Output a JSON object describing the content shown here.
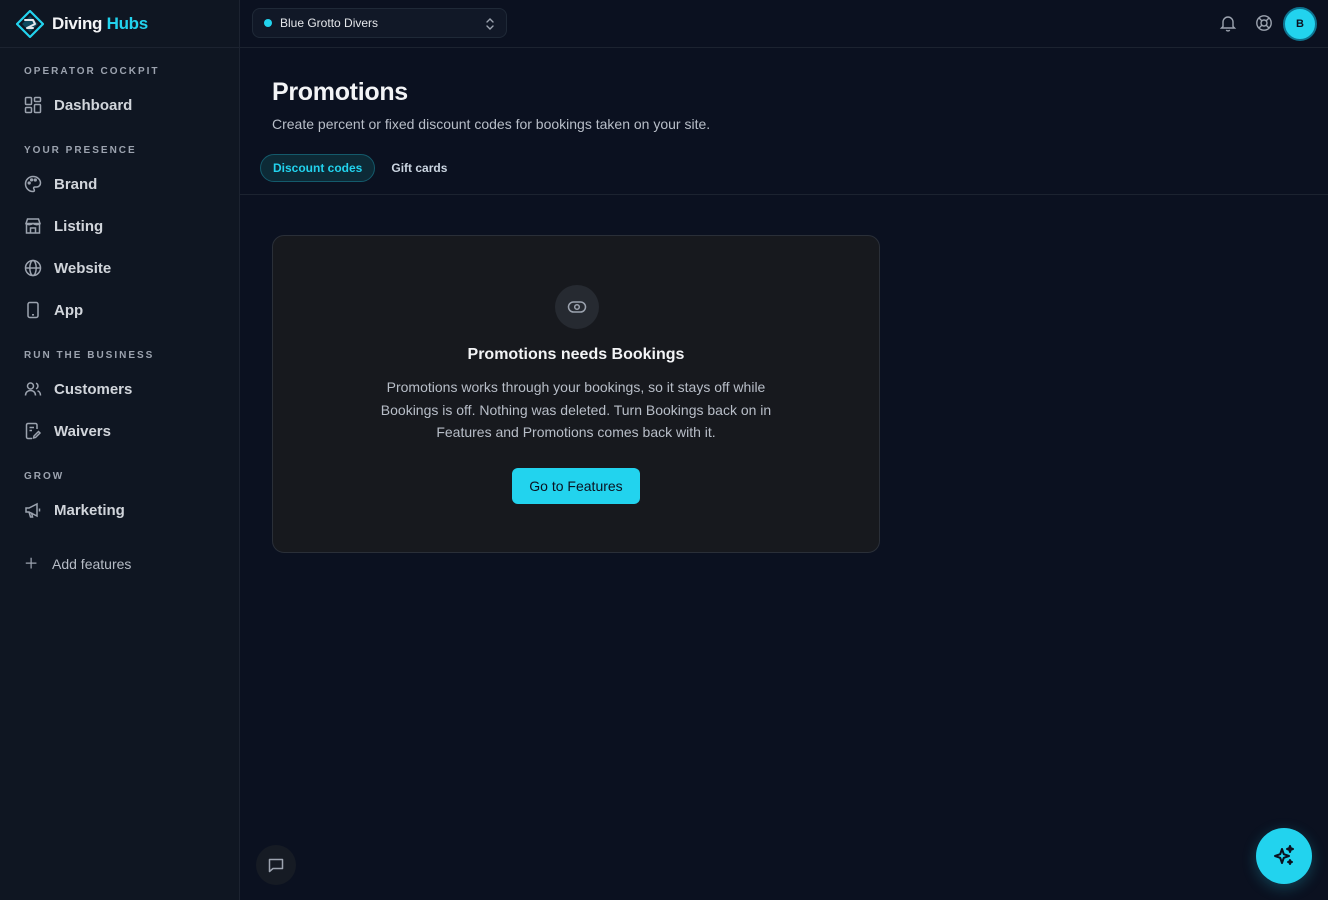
{
  "app": {
    "brand_part1": "Diving",
    "brand_part2": "Hubs",
    "accent_color": "#22d3ee"
  },
  "topbar": {
    "org_name": "Blue Grotto Divers",
    "avatar_initial": "B",
    "icons": [
      "bell-icon",
      "help-icon"
    ]
  },
  "sidebar": {
    "sections": [
      {
        "label": "Operator Cockpit"
      },
      {
        "label": "Your Presence"
      },
      {
        "label": "Run the Business"
      },
      {
        "label": "Grow"
      }
    ],
    "items": [
      {
        "label": "Dashboard",
        "icon": "dashboard-icon"
      },
      {
        "label": "Brand",
        "icon": "palette-icon"
      },
      {
        "label": "Listing",
        "icon": "store-icon"
      },
      {
        "label": "Website",
        "icon": "globe-icon"
      },
      {
        "label": "App",
        "icon": "phone-icon"
      },
      {
        "label": "Customers",
        "icon": "users-icon"
      },
      {
        "label": "Waivers",
        "icon": "document-edit-icon"
      },
      {
        "label": "Marketing",
        "icon": "megaphone-icon"
      }
    ],
    "add_features": "Add features"
  },
  "main": {
    "title": "Promotions",
    "subtitle": "Create percent or fixed discount codes for bookings taken on your site.",
    "tabs": [
      {
        "label": "Discount codes",
        "active": true
      },
      {
        "label": "Gift cards",
        "active": false
      }
    ],
    "empty_state": {
      "icon": "toggle-off-icon",
      "title": "Promotions needs Bookings",
      "message": "Promotions works through your bookings, so it stays off while Bookings is off. Nothing was deleted. Turn Bookings back on in Features and Promotions comes back with it.",
      "cta_label": "Go to Features"
    }
  }
}
